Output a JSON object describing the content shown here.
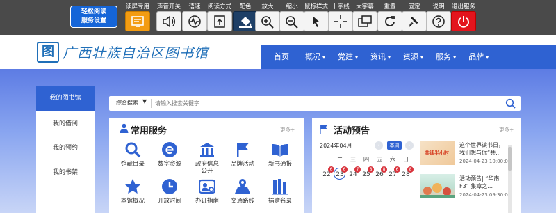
{
  "toolbar": {
    "mode_button": {
      "line1": "轻松阅读",
      "line2": "服务设置"
    },
    "items": [
      {
        "label": "读屏专用",
        "icon": "screen-reader-icon"
      },
      {
        "label": "声音开关",
        "icon": "speaker-icon"
      },
      {
        "label": "语速",
        "icon": "speech-rate-icon"
      },
      {
        "label": "阅读方式",
        "icon": "reading-mode-icon"
      },
      {
        "label": "配色",
        "icon": "paint-bucket-icon"
      },
      {
        "label": "放大",
        "icon": "zoom-in-icon"
      },
      {
        "label": "缩小",
        "icon": "zoom-out-icon"
      },
      {
        "label": "鼠标样式",
        "icon": "cursor-icon"
      },
      {
        "label": "十字线",
        "icon": "crosshair-icon"
      },
      {
        "label": "大字幕",
        "icon": "caption-icon"
      },
      {
        "label": "重置",
        "icon": "reset-icon"
      },
      {
        "label": "固定",
        "icon": "pin-icon"
      },
      {
        "label": "说明",
        "icon": "help-icon"
      },
      {
        "label": "退出服务",
        "icon": "power-icon"
      }
    ]
  },
  "header": {
    "seal_char": "图",
    "site_name": "广西壮族自治区图书馆"
  },
  "nav": [
    {
      "label": "首页",
      "dropdown": false
    },
    {
      "label": "概况",
      "dropdown": true
    },
    {
      "label": "党建",
      "dropdown": true
    },
    {
      "label": "资讯",
      "dropdown": true
    },
    {
      "label": "资源",
      "dropdown": true
    },
    {
      "label": "服务",
      "dropdown": true
    },
    {
      "label": "品牌",
      "dropdown": true
    }
  ],
  "sidebar": {
    "items": [
      "我的图书馆",
      "我的借阅",
      "我的预约",
      "我的书架"
    ]
  },
  "search": {
    "scope": "综合搜索",
    "placeholder": "请输入搜索关键字"
  },
  "services": {
    "title": "常用服务",
    "more": "更多+",
    "items": [
      {
        "label": "馆藏目录",
        "icon": "search-icon"
      },
      {
        "label": "数字资源",
        "icon": "e-resource-icon"
      },
      {
        "label": "政府信息公开",
        "label_line1": "政府信息",
        "label_line2": "公开",
        "icon": "government-building-icon"
      },
      {
        "label": "品牌活动",
        "icon": "flag-icon"
      },
      {
        "label": "新书通报",
        "icon": "open-book-icon"
      },
      {
        "label": "本馆概况",
        "icon": "star-icon"
      },
      {
        "label": "开放时间",
        "icon": "clock-icon"
      },
      {
        "label": "办证指南",
        "icon": "id-card-icon"
      },
      {
        "label": "交通路线",
        "icon": "map-route-icon"
      },
      {
        "label": "捐赠名录",
        "icon": "books-icon"
      }
    ]
  },
  "events": {
    "title": "活动预告",
    "more": "更多+",
    "calendar": {
      "month": "2024年04月",
      "week_button": "本周",
      "weekdays": [
        "一",
        "二",
        "三",
        "四",
        "五",
        "六",
        "日"
      ],
      "days": [
        "22",
        "23",
        "24",
        "25",
        "26",
        "27",
        "28"
      ],
      "counts": [
        "6",
        "6",
        "7",
        "8",
        "8",
        "6",
        "8"
      ],
      "today": "23"
    },
    "list": [
      {
        "title": "这个世界读书日，我们想与你“共...",
        "date": "2024-04-23 10:00:00",
        "thumb_text": "共读半小时"
      },
      {
        "title": "活动预告| “华南F3” 集章之...",
        "date": "2024-04-23 09:30:00"
      }
    ]
  },
  "colors": {
    "brand_blue": "#2f62d2",
    "toolbar_bg": "#4a4a4a",
    "badge_red": "#d9343d",
    "exit_red": "#e3141d",
    "highlight_orange": "#f39c12"
  }
}
